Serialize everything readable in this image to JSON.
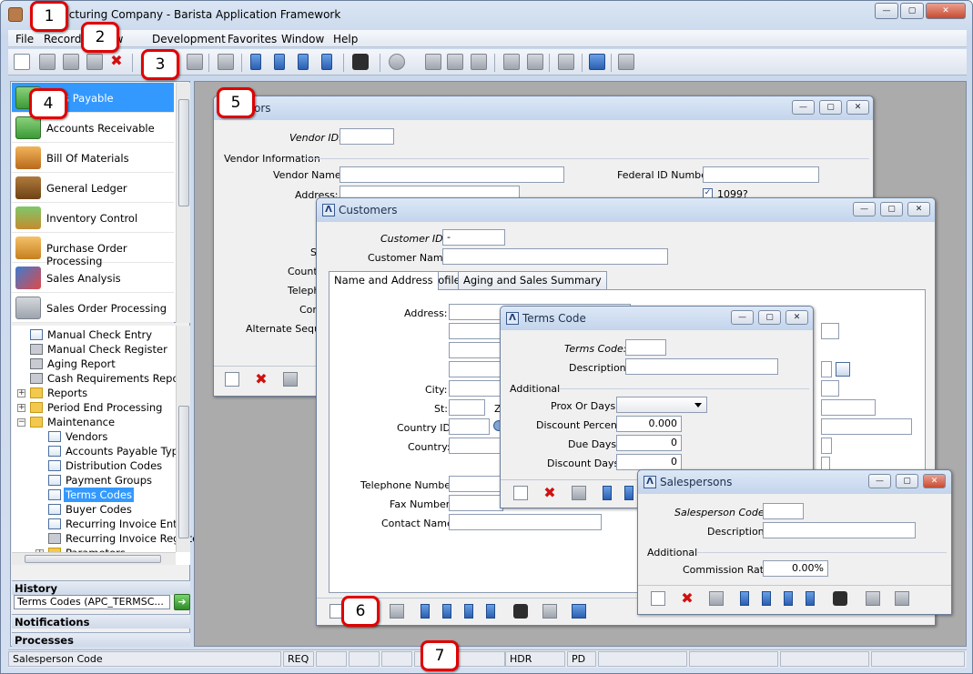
{
  "app": {
    "title": "Manufacturing Company - Barista Application Framework",
    "title_visible": "nufacturing Company - Barista Application Framework",
    "window_buttons": {
      "minimize": "—",
      "restore": "▢",
      "close": "✕"
    }
  },
  "menu": [
    "File",
    "Record",
    "View",
    "Development",
    "Favorites",
    "Window",
    "Help"
  ],
  "modules": [
    {
      "label": "Accounts Payable",
      "visible": "unts Payable",
      "icon": "money-icon",
      "selected": true
    },
    {
      "label": "Accounts Receivable",
      "icon": "cash-icon"
    },
    {
      "label": "Bill Of Materials",
      "icon": "box-icon"
    },
    {
      "label": "General Ledger",
      "icon": "ledger-book-icon"
    },
    {
      "label": "Inventory Control",
      "icon": "inventory-icon"
    },
    {
      "label": "Purchase Order Processing",
      "icon": "order-box-icon"
    },
    {
      "label": "Sales Analysis",
      "icon": "chart-icon"
    },
    {
      "label": "Sales Order Processing",
      "icon": "register-icon"
    }
  ],
  "tree": [
    {
      "label": "Manual Check Entry",
      "icon": "form-icon"
    },
    {
      "label": "Manual Check Register",
      "icon": "printer-icon"
    },
    {
      "label": "Aging Report",
      "icon": "printer-icon"
    },
    {
      "label": "Cash Requirements Report",
      "icon": "printer-icon"
    },
    {
      "label": "Reports",
      "icon": "folder-icon"
    },
    {
      "label": "Period End Processing",
      "icon": "folder-icon"
    },
    {
      "label": "Maintenance",
      "icon": "folder-open-icon"
    },
    {
      "label": "Vendors",
      "icon": "form-icon"
    },
    {
      "label": "Accounts Payable Types",
      "icon": "form-icon"
    },
    {
      "label": "Distribution Codes",
      "icon": "form-icon"
    },
    {
      "label": "Payment Groups",
      "icon": "form-icon"
    },
    {
      "label": "Terms Codes",
      "icon": "form-icon",
      "selected": true
    },
    {
      "label": "Buyer Codes",
      "icon": "form-icon"
    },
    {
      "label": "Recurring Invoice Entry",
      "icon": "form-icon"
    },
    {
      "label": "Recurring Invoice Registe",
      "icon": "printer-icon"
    },
    {
      "label": "Parameters",
      "icon": "folder-icon"
    }
  ],
  "panels": {
    "history": "History",
    "history_value": "Terms Codes (APC_TERMSC...",
    "notifications": "Notifications",
    "processes": "Processes"
  },
  "vendors": {
    "title": "Vendors",
    "title_visible": "ors",
    "vendor_id_label": "Vendor ID:",
    "vendor_info": "Vendor Information",
    "vendor_name_label": "Vendor Name:",
    "address_label": "Address:",
    "federal_id_label": "Federal ID Number:",
    "check_1099_label": "1099?",
    "st_label": "S",
    "country_label": "Countr",
    "telephone_label": "Telephe",
    "contact_label": "Con",
    "alt_seq_label": "Alternate Sequen"
  },
  "customers": {
    "title": "Customers",
    "customer_id_label": "Customer ID:",
    "customer_id_value": "-",
    "customer_name_label": "Customer Name:",
    "tabs": [
      "Name and Address",
      "Profile",
      "Aging and Sales Summary"
    ],
    "address_label": "Address:",
    "city_label": "City:",
    "st_label": "St:",
    "zip_label": "Z",
    "country_id_label": "Country ID:",
    "country_label": "Country:",
    "telephone_label": "Telephone Number:",
    "fax_label": "Fax Number:",
    "contact_label": "Contact Name:"
  },
  "terms": {
    "title": "Terms Code",
    "code_label": "Terms Code:",
    "desc_label": "Description:",
    "additional": "Additional",
    "prox_label": "Prox Or Days:",
    "disc_pct_label": "Discount Percent:",
    "disc_pct_value": "0.000",
    "due_days_label": "Due Days:",
    "due_days_value": "0",
    "disc_days_label": "Discount Days:",
    "disc_days_value": "0"
  },
  "salespersons": {
    "title": "Salespersons",
    "code_label": "Salesperson Code:",
    "desc_label": "Description:",
    "additional": "Additional",
    "commission_label": "Commission Rate:",
    "commission_value": "0.00%"
  },
  "status": {
    "message": "Salesperson Code",
    "req": "REQ",
    "hdr": "HDR",
    "pd": "PD"
  },
  "callouts": [
    "1",
    "2",
    "3",
    "4",
    "5",
    "6",
    "7"
  ]
}
